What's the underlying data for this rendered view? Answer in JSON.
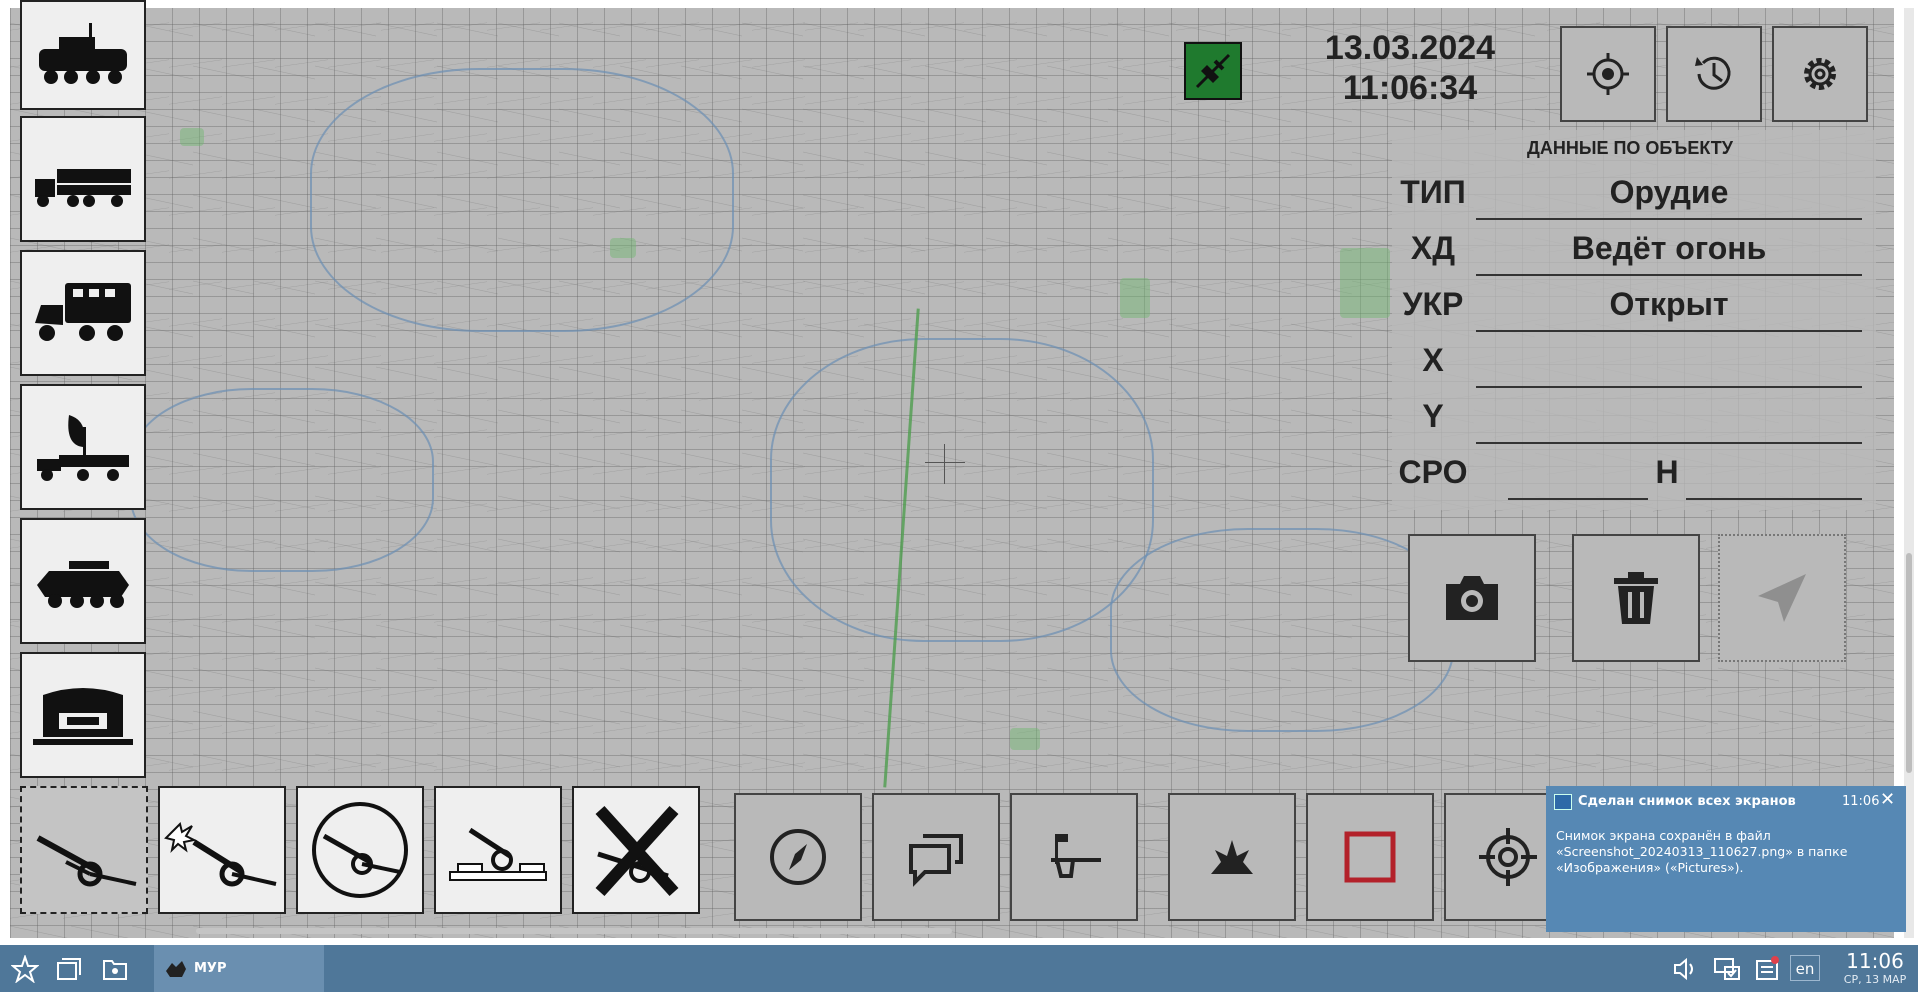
{
  "status": {
    "connection_icon": "plug-icon",
    "connection_color": "#1f7a2e",
    "date": "13.03.2024",
    "time": "11:06:34"
  },
  "top_buttons": [
    {
      "icon": "locate-icon"
    },
    {
      "icon": "history-icon"
    },
    {
      "icon": "settings-gear-icon"
    }
  ],
  "vehicles": [
    {
      "icon": "apc-icon"
    },
    {
      "icon": "missile-launcher-truck-icon"
    },
    {
      "icon": "command-truck-icon"
    },
    {
      "icon": "radar-truck-icon"
    },
    {
      "icon": "armored-missile-carrier-icon"
    },
    {
      "icon": "hangar-icon"
    }
  ],
  "guns": [
    {
      "icon": "howitzer-icon",
      "selected": true
    },
    {
      "icon": "howitzer-firing-icon"
    },
    {
      "icon": "howitzer-circled-icon"
    },
    {
      "icon": "howitzer-fortified-icon"
    },
    {
      "icon": "howitzer-destroyed-icon"
    }
  ],
  "tools": [
    {
      "icon": "compass-icon"
    },
    {
      "icon": "messages-icon"
    },
    {
      "icon": "observation-post-icon"
    },
    {
      "icon": "explosion-icon"
    },
    {
      "icon": "red-square-icon"
    },
    {
      "icon": "crosshair-target-icon"
    }
  ],
  "object_panel": {
    "title": "ДАННЫЕ ПО ОБЪЕКТУ",
    "rows": [
      {
        "label": "ТИП",
        "value": "Орудие"
      },
      {
        "label": "ХД",
        "value": "Ведёт огонь"
      },
      {
        "label": "УКР",
        "value": "Открыт"
      },
      {
        "label": "X",
        "value": ""
      },
      {
        "label": "Y",
        "value": ""
      }
    ],
    "sro_label": "СРО",
    "h_label": "Н",
    "sro_value": "",
    "h_value": ""
  },
  "action_buttons": [
    {
      "icon": "camera-icon"
    },
    {
      "icon": "trash-icon"
    },
    {
      "icon": "send-icon",
      "disabled": true
    }
  ],
  "notification": {
    "title": "Сделан снимок всех экранов",
    "time": "11:06",
    "body": "Снимок экрана сохранён в файл «Screenshot_20240313_110627.png» в папке «Изображения» («Pictures»)."
  },
  "taskbar": {
    "app_label": "МУР",
    "lang": "en",
    "clock_time": "11:06",
    "clock_date": "СР, 13 МАР"
  }
}
